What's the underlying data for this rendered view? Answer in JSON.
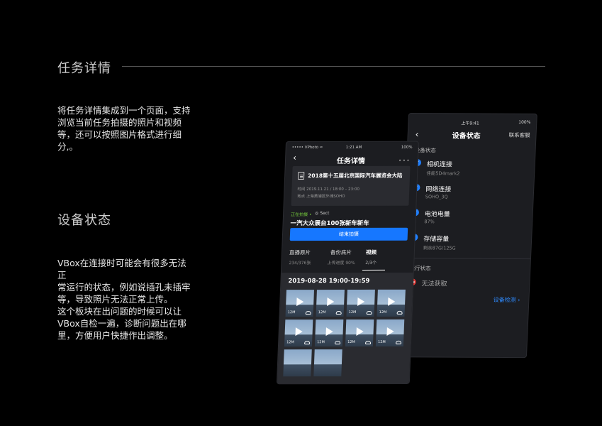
{
  "section1": {
    "title": "任务详情",
    "lines": [
      "将任务详情集成到一个页面，支持",
      "浏览当前任务拍摄的照片和视频",
      "等，还可以按照图片格式进行细",
      "分,。"
    ]
  },
  "section2": {
    "title": "设备状态",
    "lines": [
      "VBox在连接时可能会有很多无法正",
      "常运行的状态，例如说插孔未插牢",
      "等，导致照片无法正常上传。",
      "这个板块在出问题的时候可以让",
      "VBox自检一遍，诊断问题出在哪",
      "里，方便用户快捷作出调整。"
    ]
  },
  "device_status": {
    "time": "上午9:41",
    "battery": "100%",
    "back": "‹",
    "title": "设备状态",
    "contact": "联系客服",
    "device_label": "设备状态",
    "items": [
      {
        "name": "相机连接",
        "sub": "佳能5D4mark2"
      },
      {
        "name": "网络连接",
        "sub": "SOHO_3Q"
      },
      {
        "name": "电池电量",
        "sub": "87%"
      },
      {
        "name": "存储容量",
        "sub": "剩余87G/125G"
      }
    ],
    "run_label": "运行状态",
    "run_value": "无法获取",
    "check": "设备检测 ›"
  },
  "task_detail": {
    "carrier": "••••• VPhoto ≈",
    "time": "1:21 AM",
    "battery": "100%",
    "back": "‹",
    "title": "任务详情",
    "more": "•••",
    "event": "2018第十五届北京国际汽车展览会大陆",
    "time_label": "时间  2019.11.21 / 18:00 – 23:00",
    "place_label": "地点  上海黄浦区外滩SOHO",
    "live": "正在拍摄 •",
    "brand": "◎ Sect",
    "subject": "一汽大众展台100张新车新车",
    "end_button": "结束拍摄",
    "stats": [
      {
        "k": "直播原片",
        "v": "234/376张"
      },
      {
        "k": "备份底片",
        "v": "上传进度 90%"
      },
      {
        "k": "视频",
        "v": "2/3个"
      }
    ],
    "date": "2019-08-28 19:00-19:59",
    "thumb_size": "12M"
  }
}
